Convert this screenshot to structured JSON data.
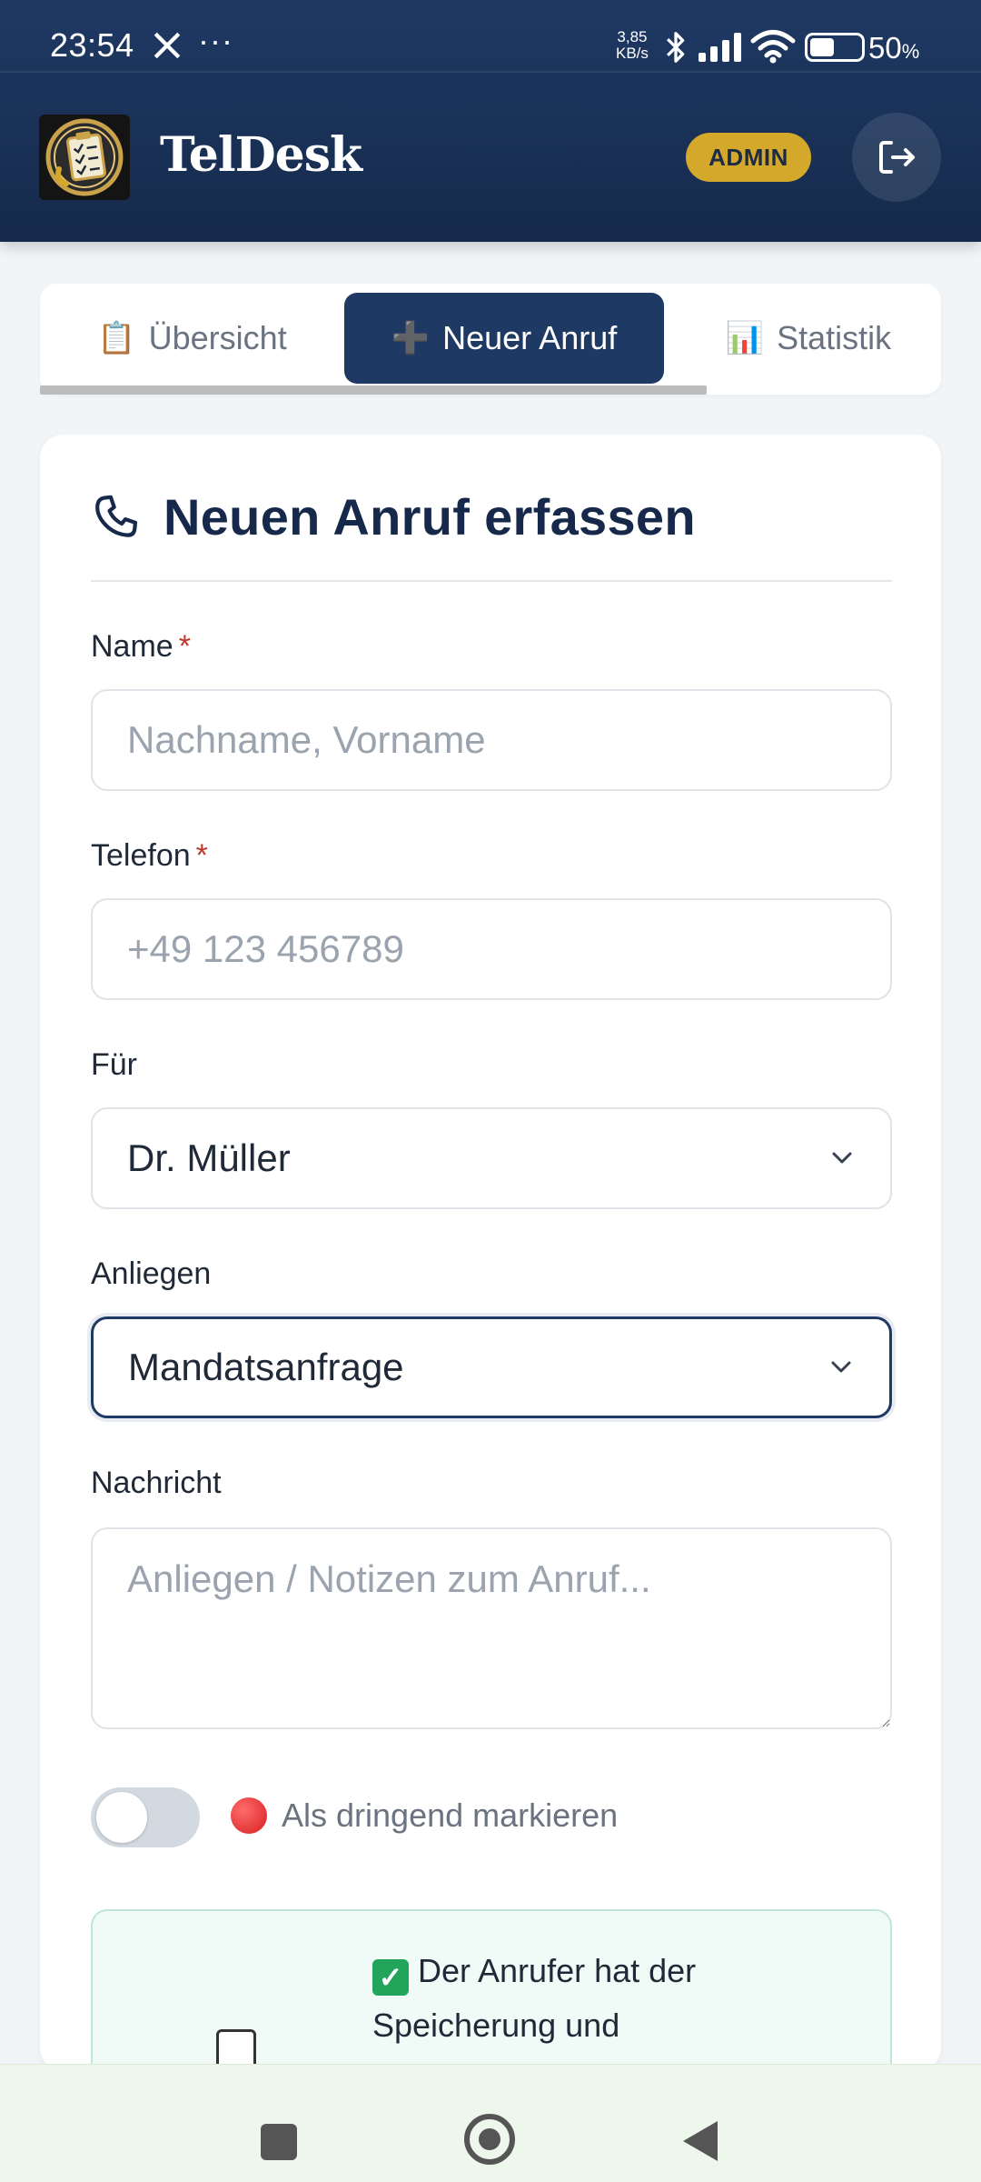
{
  "status_bar": {
    "time": "23:54",
    "dots": "···",
    "net_speed_value": "3,85",
    "net_speed_unit": "KB/s",
    "battery_percent": "50",
    "battery_unit": "%"
  },
  "header": {
    "app_name": "TelDesk",
    "role_badge": "ADMIN"
  },
  "tabs": [
    {
      "icon": "📋",
      "label": "Übersicht"
    },
    {
      "icon": "➕",
      "label": "Neuer Anruf"
    },
    {
      "icon": "📊",
      "label": "Statistik"
    }
  ],
  "form": {
    "title": "Neuen Anruf erfassen",
    "name_label": "Name",
    "name_placeholder": "Nachname, Vorname",
    "phone_label": "Telefon",
    "phone_placeholder": "+49 123 456789",
    "required_mark": "*",
    "for_label": "Für",
    "for_value": "Dr. Müller",
    "concern_label": "Anliegen",
    "concern_value": "Mandatsanfrage",
    "message_label": "Nachricht",
    "message_placeholder": "Anliegen / Notizen zum Anruf...",
    "urgent_label": "Als dringend markieren",
    "consent_line1": "Der Anrufer hat der",
    "consent_line2": "Speicherung und"
  },
  "colors": {
    "header": "#1a3157",
    "accent": "#1e3a64",
    "badge": "#d4a82a",
    "required": "#c0392b",
    "consent_bg": "#f0faf6"
  }
}
